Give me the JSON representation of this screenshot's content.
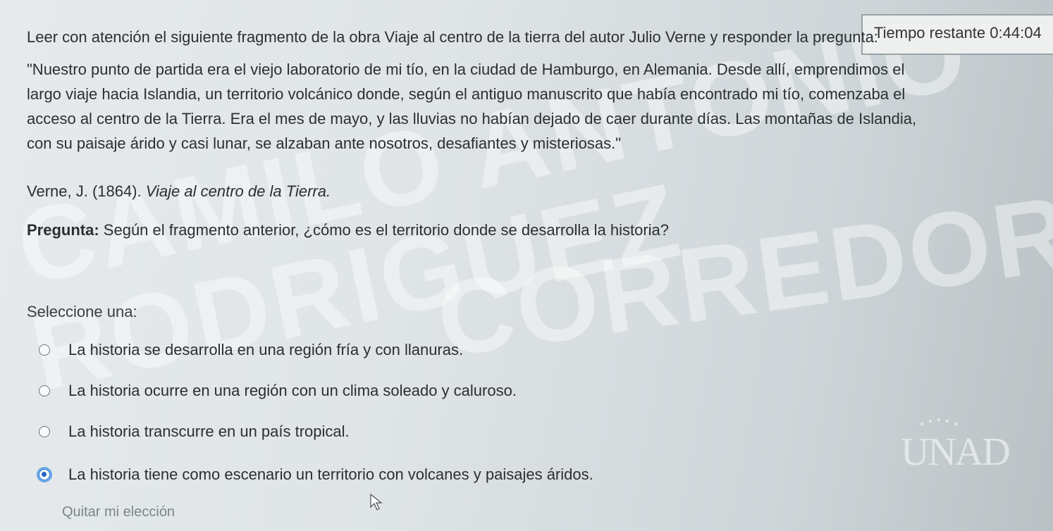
{
  "watermark": {
    "line1": "CAMILO ANTONIO",
    "line2": "RODRIGUEZ",
    "line3": "CORREDOR"
  },
  "timer": {
    "label": "Tiempo restante",
    "value": "0:44:04"
  },
  "instructions": "Leer con atención el siguiente fragmento de la obra Viaje al centro de la tierra del autor Julio Verne y responder la pregunta:",
  "passage": {
    "line1": "\"Nuestro punto de partida era el viejo laboratorio de mi tío, en la ciudad de Hamburgo, en Alemania. Desde allí, emprendimos el",
    "line2": "largo viaje hacia Islandia, un territorio volcánico donde, según el antiguo manuscrito que había encontrado mi tío, comenzaba el",
    "line3": "acceso al centro de la Tierra. Era el mes de mayo, y las lluvias no habían dejado de caer durante días. Las montañas de Islandia,",
    "line4": "con su paisaje árido y casi lunar, se alzaban ante nosotros, desafiantes y misteriosas.\""
  },
  "citation": {
    "author": "Verne, J. (1864). ",
    "work": "Viaje al centro de la Tierra."
  },
  "question": {
    "label": "Pregunta:",
    "text": " Según el fragmento anterior, ¿cómo es el territorio donde se desarrolla la historia?"
  },
  "select_label": "Seleccione una:",
  "options": [
    {
      "label": "La historia se desarrolla en una región fría y con llanuras.",
      "selected": false
    },
    {
      "label": "La historia ocurre en una región con un clima soleado y caluroso.",
      "selected": false
    },
    {
      "label": "La historia transcurre en un país tropical.",
      "selected": false
    },
    {
      "label": "La historia tiene como escenario un territorio con volcanes y paisajes áridos.",
      "selected": true
    }
  ],
  "clear_choice": "Quitar mi elección",
  "logo": {
    "name": "unad-logo",
    "text": "UNAD"
  },
  "colors": {
    "selected_radio": "#2563c4",
    "text": "#2b2f33",
    "link": "#7a858c"
  }
}
